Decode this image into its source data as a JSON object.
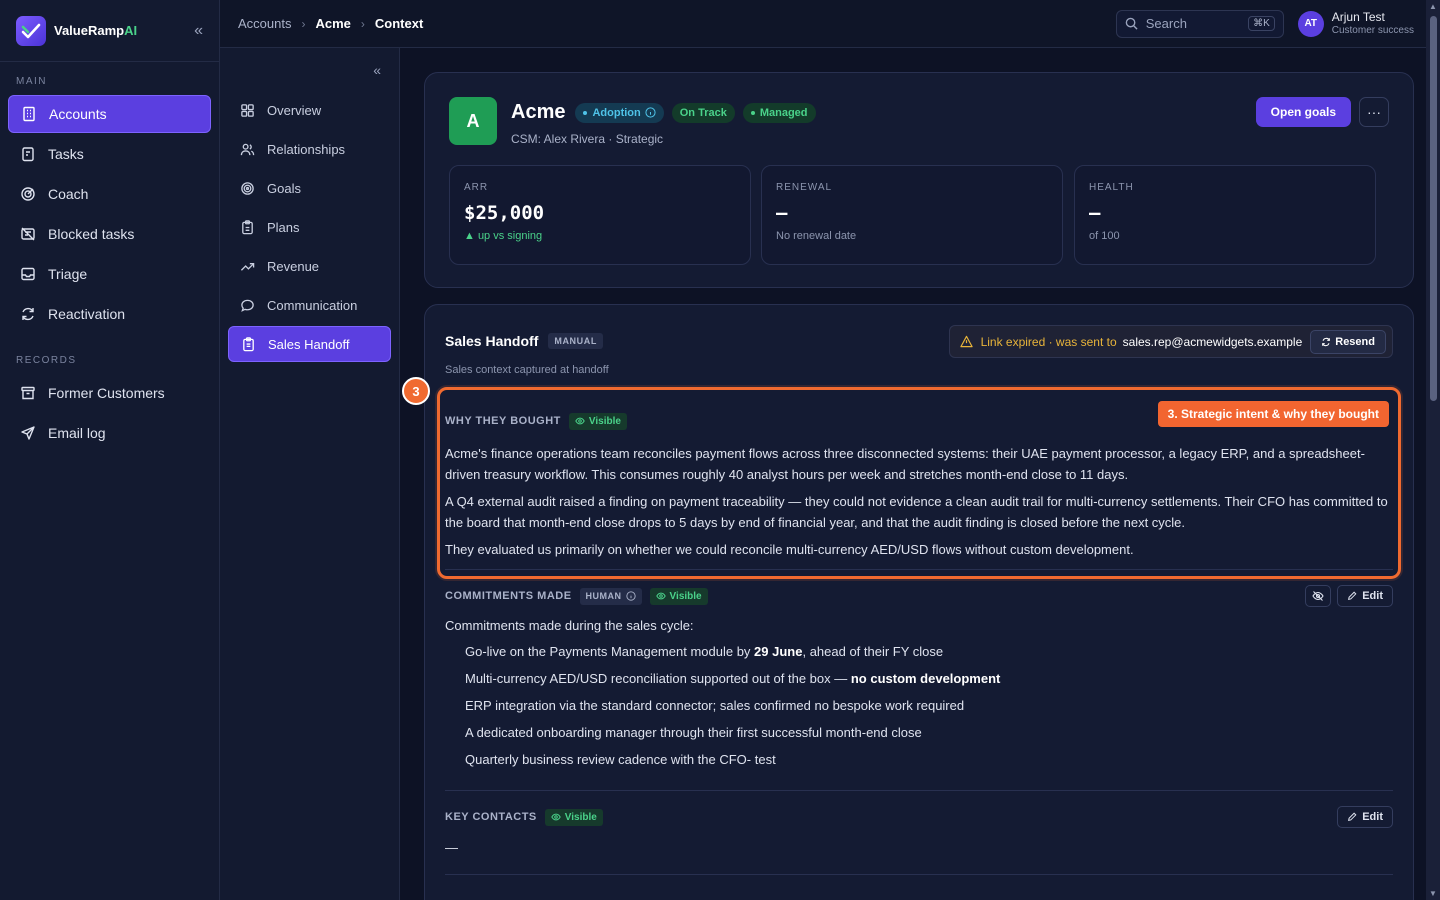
{
  "brand": {
    "name": "ValueRamp",
    "ai": "AI"
  },
  "sidebar": {
    "main_label": "MAIN",
    "records_label": "RECORDS",
    "main_items": [
      {
        "label": "Accounts",
        "icon": "building-icon"
      },
      {
        "label": "Tasks",
        "icon": "clipboard-icon"
      },
      {
        "label": "Coach",
        "icon": "target-icon"
      },
      {
        "label": "Blocked tasks",
        "icon": "blocked-icon"
      },
      {
        "label": "Triage",
        "icon": "inbox-icon"
      },
      {
        "label": "Reactivation",
        "icon": "refresh-icon"
      }
    ],
    "record_items": [
      {
        "label": "Former Customers",
        "icon": "archive-icon"
      },
      {
        "label": "Email log",
        "icon": "send-icon"
      }
    ]
  },
  "subnav": {
    "items": [
      {
        "label": "Overview"
      },
      {
        "label": "Relationships"
      },
      {
        "label": "Goals"
      },
      {
        "label": "Plans"
      },
      {
        "label": "Revenue"
      },
      {
        "label": "Communication"
      },
      {
        "label": "Sales Handoff"
      }
    ]
  },
  "breadcrumb": [
    "Accounts",
    "Acme",
    "Context"
  ],
  "search": {
    "placeholder": "Search",
    "shortcut": "⌘K"
  },
  "user": {
    "initials": "AT",
    "name": "Arjun Test",
    "role": "Customer success"
  },
  "account": {
    "initial": "A",
    "name": "Acme",
    "badges": [
      "Adoption",
      "On Track",
      "Managed"
    ],
    "subtitle": "CSM: Alex Rivera · Strategic",
    "open_goals": "Open goals",
    "more": "···",
    "metrics": [
      {
        "label": "ARR",
        "value": "$25,000",
        "note": "▲ up vs signing"
      },
      {
        "label": "RENEWAL",
        "value": "—",
        "note": "No renewal date"
      },
      {
        "label": "HEALTH",
        "value": "—",
        "note": "of 100"
      }
    ]
  },
  "handoff": {
    "title": "Sales Handoff",
    "tag": "MANUAL",
    "subtitle": "Sales context captured at handoff",
    "warning": "Link expired · was sent to",
    "email": "sales.rep@acmewidgets.example",
    "resend": "Resend",
    "visible_label": "Visible",
    "edit_label": "Edit",
    "human_label": "HUMAN",
    "why_bought": {
      "title": "WHY THEY BOUGHT",
      "paragraphs": [
        "Acme's finance operations team reconciles payment flows across three disconnected systems: their UAE payment processor, a legacy ERP, and a spreadsheet-driven treasury workflow. This consumes roughly 40 analyst hours per week and stretches month-end close to 11 days.",
        "A Q4 external audit raised a finding on payment traceability — they could not evidence a clean audit trail for multi-currency settlements. Their CFO has committed to the board that month-end close drops to 5 days by end of financial year, and that the audit finding is closed before the next cycle.",
        "They evaluated us primarily on whether we could reconcile multi-currency AED/USD flows without custom development."
      ]
    },
    "commitments": {
      "title": "COMMITMENTS MADE",
      "intro": "Commitments made during the sales cycle:",
      "items": [
        {
          "pre": "Go-live on the Payments Management module by ",
          "bold": "29 June",
          "post": ", ahead of their FY close"
        },
        {
          "pre": "Multi-currency AED/USD reconciliation supported out of the box — ",
          "bold": "no custom development",
          "post": ""
        },
        {
          "pre": "ERP integration via the standard connector; sales confirmed no bespoke work required",
          "bold": "",
          "post": ""
        },
        {
          "pre": "A dedicated onboarding manager through their first successful month-end close",
          "bold": "",
          "post": ""
        },
        {
          "pre": "Quarterly business review cadence with the CFO- test",
          "bold": "",
          "post": ""
        }
      ]
    },
    "key_contacts": {
      "title": "KEY CONTACTS",
      "value": "—"
    }
  },
  "tour": {
    "step": "3",
    "label": "3. Strategic intent & why they bought",
    "color": "#f06a30"
  }
}
